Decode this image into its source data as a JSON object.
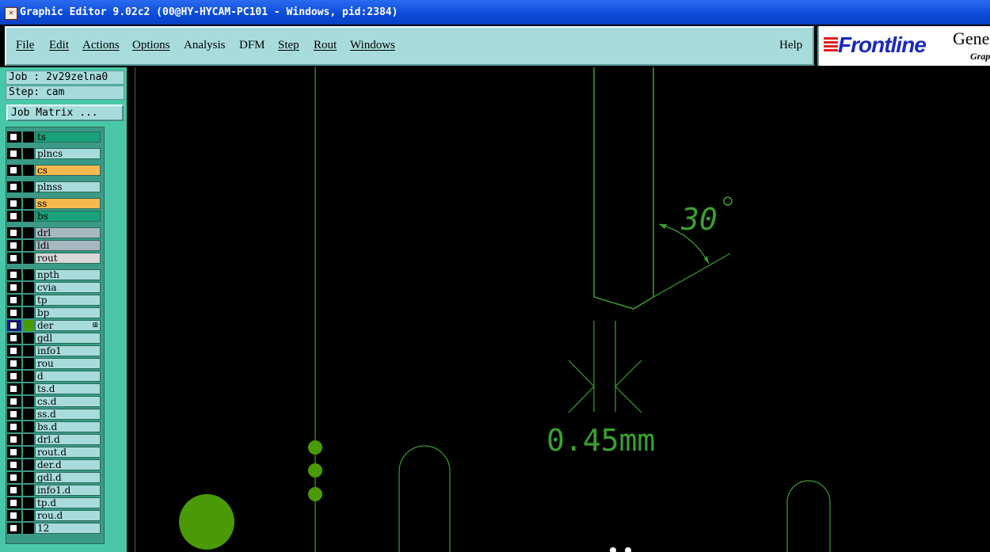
{
  "window": {
    "title": "Graphic Editor 9.02c2 (00@HY-HYCAM-PC101 - Windows, pid:2384)"
  },
  "menu": {
    "items": [
      "File",
      "Edit",
      "Actions",
      "Options",
      "Analysis",
      "DFM",
      "Step",
      "Rout",
      "Windows"
    ],
    "help": "Help"
  },
  "logo": {
    "brand": "Frontline",
    "product": "Gene",
    "product_sub": "Grap"
  },
  "job": {
    "job_label": "Job : 2v29zelna0",
    "step_label": "Step: cam",
    "matrix_button": "Job Matrix ..."
  },
  "layers": [
    {
      "name": "ts",
      "color": "#1aa07a"
    },
    {
      "name": "plncs",
      "color": "#a8dcdc"
    },
    {
      "name": "cs",
      "color": "#f8b850"
    },
    {
      "name": "plnss",
      "color": "#a8dcdc"
    },
    {
      "name": "ss",
      "color": "#f8b850"
    },
    {
      "name": "bs",
      "color": "#1aa07a"
    },
    {
      "name": "drl",
      "color": "#a8b8c0"
    },
    {
      "name": "ldi",
      "color": "#a8b8c0"
    },
    {
      "name": "rout",
      "color": "#d8d8d8"
    },
    {
      "name": "npth",
      "color": "#a8dcdc"
    },
    {
      "name": "cvia",
      "color": "#a8dcdc"
    },
    {
      "name": "tp",
      "color": "#a8dcdc"
    },
    {
      "name": "bp",
      "color": "#a8dcdc"
    },
    {
      "name": "der",
      "color": "#a8dcdc",
      "active": true
    },
    {
      "name": "gdl",
      "color": "#a8dcdc"
    },
    {
      "name": "info1",
      "color": "#a8dcdc"
    },
    {
      "name": "rou",
      "color": "#a8dcdc"
    },
    {
      "name": "d",
      "color": "#a8dcdc"
    },
    {
      "name": "ts.d",
      "color": "#a8dcdc"
    },
    {
      "name": "cs.d",
      "color": "#a8dcdc"
    },
    {
      "name": "ss.d",
      "color": "#a8dcdc"
    },
    {
      "name": "bs.d",
      "color": "#a8dcdc"
    },
    {
      "name": "drl.d",
      "color": "#a8dcdc"
    },
    {
      "name": "rout.d",
      "color": "#a8dcdc"
    },
    {
      "name": "der.d",
      "color": "#a8dcdc"
    },
    {
      "name": "gdl.d",
      "color": "#a8dcdc"
    },
    {
      "name": "info1.d",
      "color": "#a8dcdc"
    },
    {
      "name": "tp.d",
      "color": "#a8dcdc"
    },
    {
      "name": "rou.d",
      "color": "#a8dcdc"
    },
    {
      "name": "12",
      "color": "#a8dcdc"
    }
  ],
  "canvas": {
    "angle_text": "30",
    "dimension_text": "0.45mm",
    "line_color": "#3aa030",
    "pad_color": "#4a9a08"
  }
}
